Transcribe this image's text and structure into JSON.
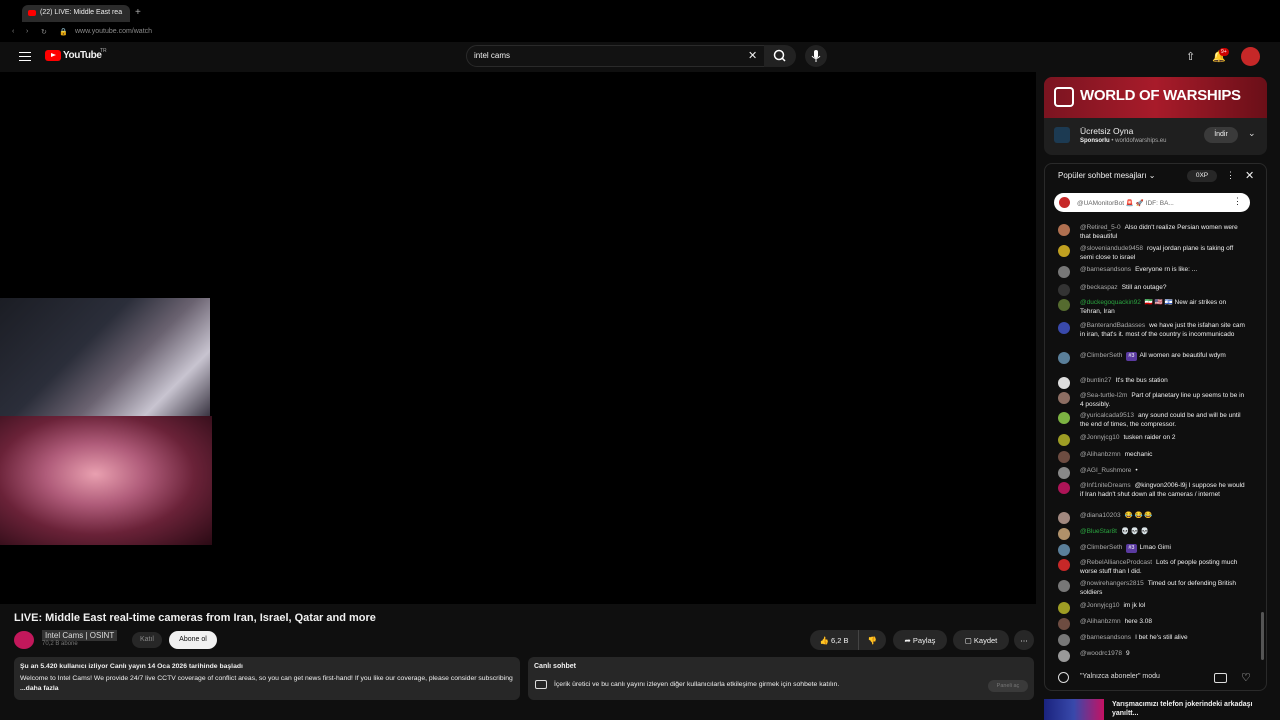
{
  "browser": {
    "tab_title": "(22) LIVE: Middle East rea",
    "url": "www.youtube.com/watch"
  },
  "header": {
    "logo_text": "YouTube",
    "logo_tm": "TR",
    "search_value": "intel cams"
  },
  "video": {
    "title": "LIVE: Middle East real-time cameras from Iran, Israel, Qatar and more",
    "channel_name": "Intel Cams | OSINT",
    "subscribers": "70,2 B abone",
    "join_label": "Katıl",
    "subscribe_label": "Abone ol",
    "likes": "6,2 B",
    "share_label": "Paylaş",
    "save_label": "Kaydet"
  },
  "description": {
    "stats": "Şu an 5.420 kullanıcı izliyor  Canlı yayın 14 Oca 2026 tarihinde başladı",
    "text": "Welcome to Intel Cams! We provide 24/7 live CCTV coverage of conflict areas, so you can get news first-hand! If you like our coverage, please consider subscribing",
    "more": "...daha fazla"
  },
  "live_chat_box": {
    "title": "Canlı sohbet",
    "text": "İçerik üretici ve bu canlı yayını izleyen diğer kullanıcılarla etkileşime girmek için sohbete katılın.",
    "button": "Paneli aç"
  },
  "ad": {
    "banner": "WORLD OF WARSHIPS",
    "headline": "Ücretsiz Oyna",
    "sponsor": "Sponsorlu",
    "domain": "worldofwarships.eu",
    "button": "İndir"
  },
  "chat": {
    "header": "Popüler sohbet mesajları",
    "xp": "0XP",
    "pinned": "@UAMonitorBot  🚨 🚀 IDF: BA...",
    "footer": "\"Yalnızca aboneler\" modu",
    "messages": [
      {
        "author": "@Retired_5-0",
        "text": "Also didn't realize Persian women were that beautiful",
        "color": "#b07050"
      },
      {
        "author": "@sloveniandude9458",
        "text": "royal jordan plane is taking off semi close to israel",
        "color": "#c0a020"
      },
      {
        "author": "@barnesandsons",
        "text": "Everyone rn is like: ...",
        "color": "#777"
      },
      {
        "author": "@beckaspaz",
        "text": "Still an outage?",
        "color": "#333"
      },
      {
        "author": "@duckegoquackin92",
        "text": "🇮🇷 🇺🇸 🇮🇱 New air strikes on Tehran, Iran",
        "color": "#556b2f",
        "green": true
      },
      {
        "author": "@BanterandBadasses",
        "text": "we have just the isfahan site cam in iran, that's it. most of the country is incommunicado",
        "color": "#3949ab"
      },
      {
        "author": "@ClimberSeth",
        "badge": "#3",
        "text": "All women are beautiful wdym",
        "color": "#5a7f9a"
      },
      {
        "author": "@buntin27",
        "text": "It's the bus station",
        "color": "#ddd"
      },
      {
        "author": "@Sea-turtle-l2m",
        "text": "Part of planetary line up seems to be in 4 possibly.",
        "color": "#8d6e63"
      },
      {
        "author": "@yuricalcada9513",
        "text": "any sound could be and will be until the end of times, the compressor.",
        "color": "#7cb342"
      },
      {
        "author": "@Jonnyjcg10",
        "text": "tusken raider on 2",
        "color": "#9e9d24"
      },
      {
        "author": "@Alihanbzmn",
        "text": "mechanic",
        "color": "#6d4c41"
      },
      {
        "author": "@AGI_Rushmore",
        "text": "•",
        "color": "#888"
      },
      {
        "author": "@Inf1niteDreams",
        "text": "@kingvon2006-l9j I suppose he would if Iran hadn't shut down all the cameras / internet",
        "color": "#ad1457"
      },
      {
        "author": "@diana10203",
        "text": "😂 😂 😂",
        "color": "#a1887f"
      },
      {
        "author": "@BlueStar8t",
        "text": "💀 💀 💀",
        "color": "#b0916a",
        "green": true
      },
      {
        "author": "@ClimberSeth",
        "badge": "#3",
        "text": "Lmao Gimi",
        "color": "#5a7f9a"
      },
      {
        "author": "@RebelAllianceProdcast",
        "text": "Lots of people posting much worse stuff than I did.",
        "color": "#c62828"
      },
      {
        "author": "@nowirehangers2815",
        "text": "Timed out for defending British soldiers",
        "color": "#777"
      },
      {
        "author": "@Jonnyjcg10",
        "text": "im jk lol",
        "color": "#9e9d24"
      },
      {
        "author": "@Alihanbzmn",
        "text": "here 3.08",
        "color": "#6d4c41"
      },
      {
        "author": "@barnesandsons",
        "text": "I bet he's still alive",
        "color": "#777"
      },
      {
        "author": "@woodrc1978",
        "text": "9",
        "color": "#999"
      }
    ]
  },
  "recommendation": {
    "title": "Yarışmacımızı telefon jokerindeki arkadaşı yanıltt..."
  }
}
